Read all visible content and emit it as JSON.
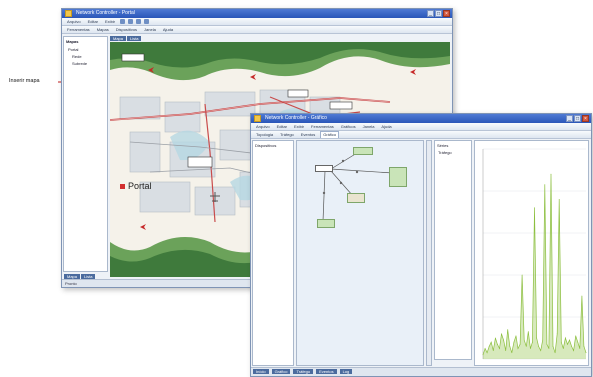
{
  "annotation": {
    "label": "Inserir mapa"
  },
  "back_window": {
    "title": "Network Controller - Portal",
    "menu_items": [
      "Arquivo",
      "Editar",
      "Exibir",
      "Ferramentas",
      "Mapas",
      "Dispositivos",
      "Janela",
      "Ajuda"
    ],
    "tree": {
      "header": "Mapas",
      "items": [
        "Portal",
        "Rede",
        "Subrede"
      ]
    },
    "map_tabs": [
      "Mapa",
      "Lista"
    ],
    "map": {
      "place_label": "Portal",
      "place_color": "#d22f2f"
    },
    "bottom_tabs": [
      "Mapa",
      "Lista"
    ],
    "status": "Pronto"
  },
  "front_window": {
    "title": "Network Controller - Gráfico",
    "menu_items": [
      "Arquivo",
      "Editar",
      "Exibir",
      "Ferramentas",
      "Gráficos",
      "Janela",
      "Ajuda"
    ],
    "tabs": [
      "Topologia",
      "Tráfego",
      "Eventos",
      "Gráfico"
    ],
    "left_list_header": "Dispositivos",
    "chart_list_header": "Séries",
    "chart_list_items": [
      "Tráfego"
    ],
    "bottom_tabs": [
      "Início",
      "Gráfico",
      "Tráfego",
      "Eventos",
      "Log"
    ]
  },
  "chart_data": {
    "type": "line",
    "color": "#8cbf3f",
    "x": [
      0,
      2,
      4,
      6,
      8,
      10,
      12,
      14,
      16,
      18,
      20,
      22,
      24,
      26,
      28,
      30,
      32,
      34,
      36,
      38,
      40,
      42,
      44,
      46,
      48,
      50,
      52,
      54,
      56,
      58,
      60,
      62,
      64,
      66,
      68,
      70,
      72,
      74,
      76,
      78,
      80,
      82,
      84,
      86,
      88,
      90,
      92,
      94,
      96,
      98,
      100
    ],
    "values": [
      2,
      5,
      3,
      6,
      8,
      4,
      10,
      7,
      5,
      12,
      9,
      4,
      14,
      6,
      3,
      8,
      11,
      5,
      7,
      40,
      9,
      6,
      13,
      5,
      8,
      72,
      10,
      6,
      4,
      9,
      83,
      7,
      5,
      88,
      6,
      3,
      12,
      76,
      8,
      5,
      10,
      7,
      9,
      6,
      4,
      11,
      8,
      5,
      30,
      6,
      3
    ]
  }
}
